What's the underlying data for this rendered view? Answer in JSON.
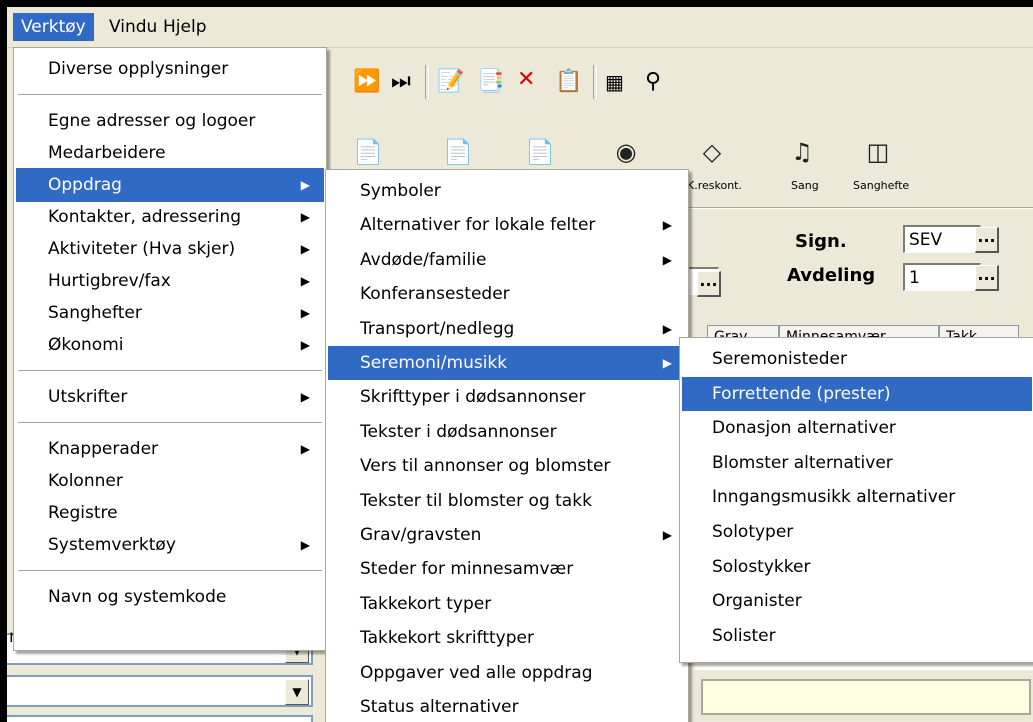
{
  "menubar": [
    "Verktøy",
    "Vindu",
    "Hjelp"
  ],
  "toolbar": {
    "icons": [
      "fast-forward-icon",
      "skip-end-icon",
      "edit-doc-icon",
      "arrow-doc-icon",
      "delete-icon",
      "copy-icon",
      "calculator-icon",
      "key-icon"
    ],
    "big_buttons": [
      {
        "icon": "doc-up-icon",
        "label": ""
      },
      {
        "icon": "doc-up-icon",
        "label": ""
      },
      {
        "icon": "doc-down-icon",
        "label": ""
      },
      {
        "icon": "piggy-bank-icon",
        "label": ""
      },
      {
        "icon": "book-icon",
        "label": "K.reskont."
      },
      {
        "icon": "music-icon",
        "label": "Sang"
      },
      {
        "icon": "booklet-icon",
        "label": "Sanghefte"
      }
    ]
  },
  "form": {
    "sign_label": "Sign.",
    "sign_value": "SEV",
    "avdeling_label": "Avdeling",
    "avdeling_value": "1",
    "tabs": [
      "Grav",
      "Minnesamvær",
      "Takk"
    ],
    "left_text": "ng"
  },
  "menu1": {
    "items": [
      {
        "label": "Diverse opplysninger",
        "arrow": false
      },
      {
        "sep": true
      },
      {
        "label": "Egne adresser og logoer",
        "arrow": false
      },
      {
        "label": "Medarbeidere",
        "arrow": false
      },
      {
        "label": "Oppdrag",
        "arrow": true,
        "highlight": true
      },
      {
        "label": "Kontakter, adressering",
        "arrow": true
      },
      {
        "label": "Aktiviteter (Hva skjer)",
        "arrow": true
      },
      {
        "label": "Hurtigbrev/fax",
        "arrow": true
      },
      {
        "label": "Sanghefter",
        "arrow": true
      },
      {
        "label": "Økonomi",
        "arrow": true
      },
      {
        "sep": true
      },
      {
        "label": "Utskrifter",
        "arrow": true
      },
      {
        "sep": true
      },
      {
        "label": "Knapperader",
        "arrow": true
      },
      {
        "label": "Kolonner",
        "arrow": false
      },
      {
        "label": "Registre",
        "arrow": false
      },
      {
        "label": "Systemverktøy",
        "arrow": true
      },
      {
        "sep": true
      },
      {
        "label": "Navn og systemkode",
        "arrow": false
      }
    ]
  },
  "menu2": {
    "items": [
      {
        "label": "Symboler",
        "arrow": false
      },
      {
        "label": "Alternativer for lokale felter",
        "arrow": true
      },
      {
        "label": "Avdøde/familie",
        "arrow": true
      },
      {
        "label": "Konferansesteder",
        "arrow": false
      },
      {
        "label": "Transport/nedlegg",
        "arrow": true
      },
      {
        "label": "Seremoni/musikk",
        "arrow": true,
        "highlight": true
      },
      {
        "label": "Skrifttyper i dødsannonser",
        "arrow": false
      },
      {
        "label": "Tekster i dødsannonser",
        "arrow": false
      },
      {
        "label": "Vers til annonser og blomster",
        "arrow": false
      },
      {
        "label": "Tekster til blomster og takk",
        "arrow": false
      },
      {
        "label": "Grav/gravsten",
        "arrow": true
      },
      {
        "label": "Steder for minnesamvær",
        "arrow": false
      },
      {
        "label": "Takkekort typer",
        "arrow": false
      },
      {
        "label": "Takkekort skrifttyper",
        "arrow": false
      },
      {
        "label": "Oppgaver ved alle oppdrag",
        "arrow": false
      },
      {
        "label": "Status alternativer",
        "arrow": false
      }
    ]
  },
  "menu3": {
    "items": [
      {
        "label": "Seremonisteder",
        "arrow": false
      },
      {
        "label": "Forrettende (prester)",
        "arrow": false,
        "highlight": true
      },
      {
        "label": "Donasjon alternativer",
        "arrow": false
      },
      {
        "label": "Blomster alternativer",
        "arrow": false
      },
      {
        "label": "Inngangsmusikk  alternativer",
        "arrow": false
      },
      {
        "label": "Solotyper",
        "arrow": false
      },
      {
        "label": "Solostykker",
        "arrow": false
      },
      {
        "label": "Organister",
        "arrow": false
      },
      {
        "label": "Solister",
        "arrow": false
      }
    ]
  },
  "arrow_glyph": "▶",
  "colors": {
    "highlight": "#316ac5",
    "menu_bg": "#ffffff",
    "window_bg": "#ece9d8"
  }
}
